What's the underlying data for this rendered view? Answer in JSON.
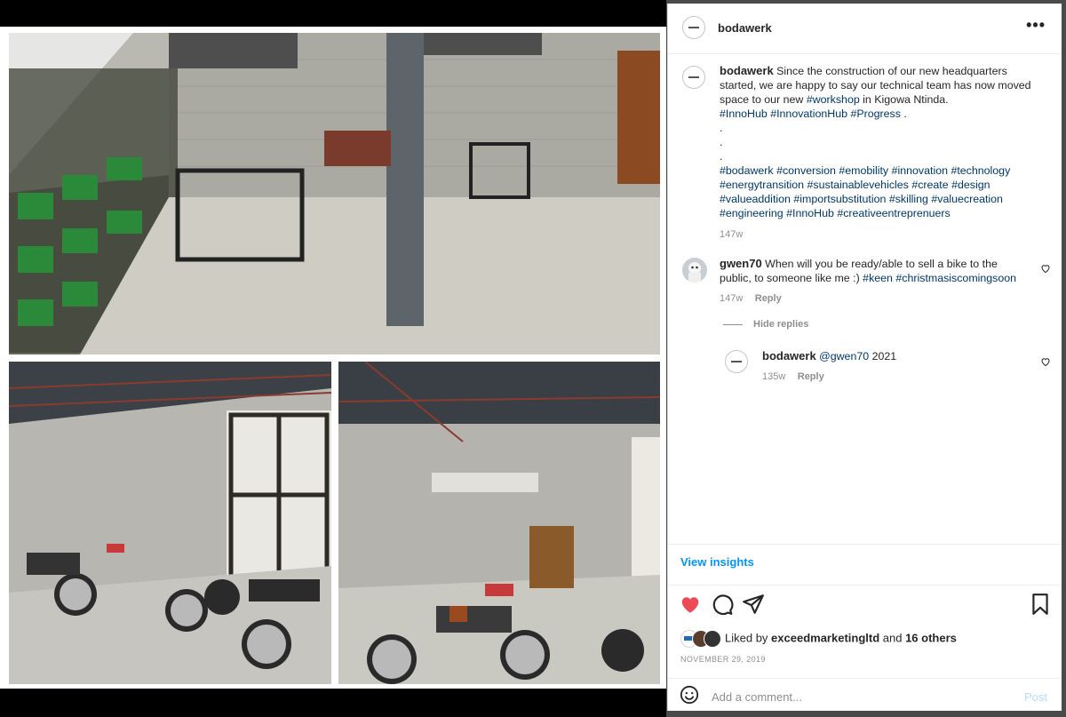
{
  "post": {
    "username": "bodawerk",
    "more_icon": "more-horizontal-icon",
    "caption": {
      "username": "bodawerk",
      "part1": " Since the construction of our new headquarters started, we are happy to say our technical team has now moved space to our new ",
      "tag_workshop": "#workshop",
      "part2": " in Kigowa Ntinda.",
      "tag_innohub": "#InnoHub",
      "tag_innovationhub": "#InnovationHub",
      "tag_progress": "#Progress",
      "period": ".",
      "dot1": ".",
      "dot2": ".",
      "dot3": ".",
      "hashtags": [
        "#bodawerk",
        "#conversion",
        "#emobility",
        "#innovation",
        "#technology",
        "#energytransition",
        "#sustainablevehicles",
        "#create",
        "#design",
        "#valueaddition",
        "#importsubstitution",
        "#skilling",
        "#valuecreation",
        "#engineering",
        "#InnoHub",
        "#creativeentreprenuers"
      ],
      "time": "147w"
    },
    "comments": [
      {
        "username": "gwen70",
        "text": "When will you be ready/able to sell a bike to the public, to someone like me :)",
        "tag1": "#keen",
        "tag2": "#christmasiscomingsoon",
        "time": "147w",
        "reply_label": "Reply",
        "hide_replies": "Hide replies"
      },
      {
        "username": "bodawerk",
        "mention": "@gwen70",
        "text": "2021",
        "time": "135w",
        "reply_label": "Reply"
      }
    ],
    "view_insights": "View insights",
    "liked_by_prefix": "Liked by ",
    "liked_by_user": "exceedmarketingltd",
    "liked_by_and": " and ",
    "liked_by_others": "16 others",
    "date": "NOVEMBER 29, 2019",
    "add_comment_placeholder": "Add a comment...",
    "post_label": "Post",
    "colors": {
      "like": "#ed4956",
      "link": "#0095f6",
      "hashtag": "#00376b"
    }
  }
}
